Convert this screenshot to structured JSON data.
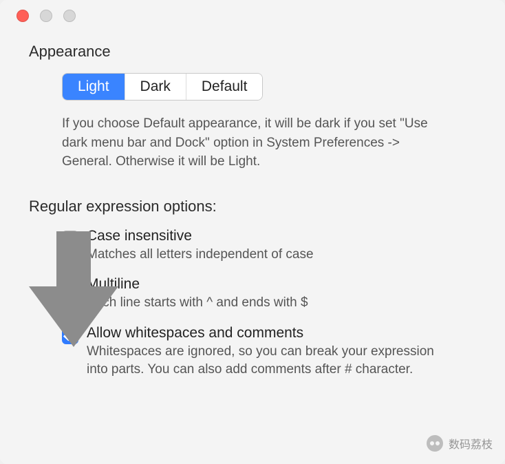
{
  "appearance": {
    "title": "Appearance",
    "options": [
      "Light",
      "Dark",
      "Default"
    ],
    "selected_index": 0,
    "hint": "If you choose Default appearance, it will be dark if you set \"Use dark menu bar and Dock\" option in System Preferences -> General. Otherwise it will be Light."
  },
  "regex": {
    "title": "Regular expression options:",
    "items": [
      {
        "label": "Case insensitive",
        "desc": "Matches all letters independent of case",
        "checked": false
      },
      {
        "label": "Multiline",
        "desc": "Each line starts with ^ and ends with $",
        "checked": false
      },
      {
        "label": "Allow whitespaces and comments",
        "desc": "Whitespaces are ignored, so you can break your expression into parts. You can also add comments after # character.",
        "checked": true
      }
    ]
  },
  "watermark": {
    "text": "数码荔枝"
  }
}
